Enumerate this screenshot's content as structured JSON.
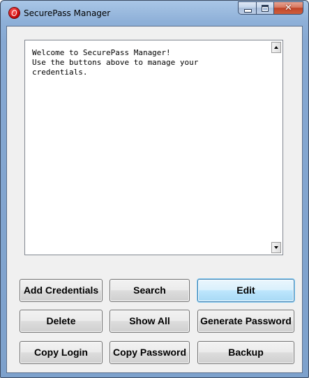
{
  "window": {
    "title": "SecurePass Manager",
    "icon": "securepass-app-icon",
    "close_glyph": "✕"
  },
  "output": {
    "text": "Welcome to SecurePass Manager!\nUse the buttons above to manage your\ncredentials."
  },
  "buttons": {
    "add_credentials": "Add Credentials",
    "search": "Search",
    "edit": "Edit",
    "delete": "Delete",
    "show_all": "Show All",
    "generate_password": "Generate Password",
    "copy_login": "Copy Login",
    "copy_password": "Copy Password",
    "backup": "Backup"
  },
  "colors": {
    "frame": "#86a8d2",
    "client_bg": "#f0f0f0",
    "default_button": "#bee6fd",
    "close_button": "#c1452a"
  }
}
